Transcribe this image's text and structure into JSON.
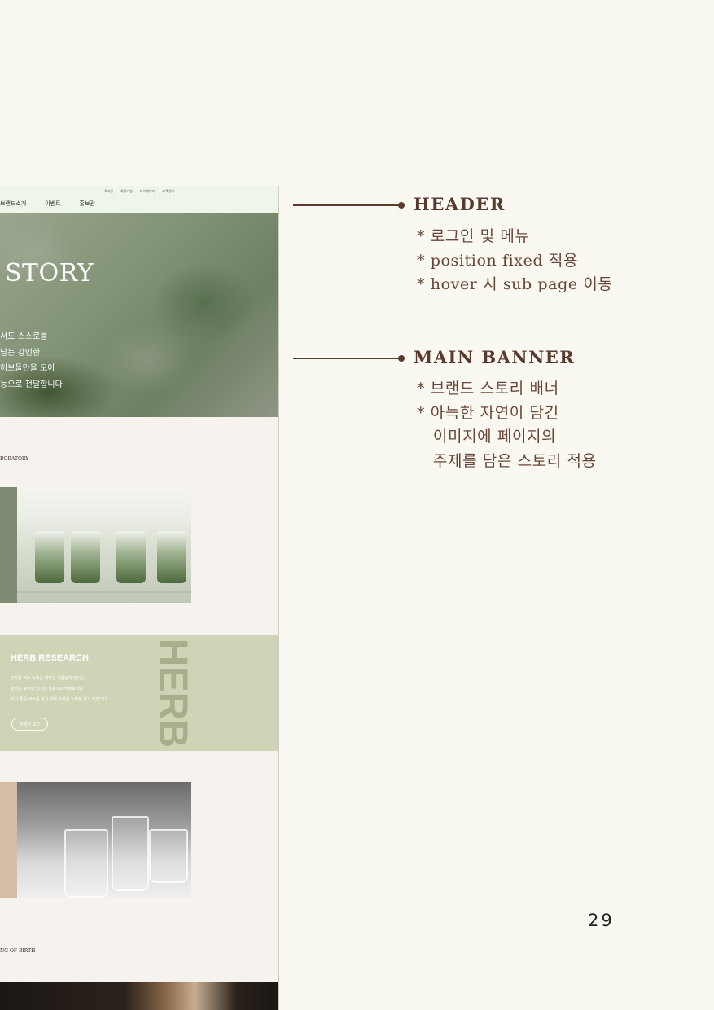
{
  "mockup": {
    "header": {
      "utility": [
        "로그인",
        "회원가입",
        "마이페이지",
        "고객센터"
      ],
      "nav": [
        "브랜드소개",
        "이벤트",
        "홍보관"
      ]
    },
    "banner": {
      "title": "STORY",
      "lines": [
        "서도 스스로를",
        "남는 강인한",
        "허브들만을 모아",
        "능으로 전달합니다"
      ]
    },
    "section1_label": "BORATORY",
    "herb": {
      "title": "HERB RESEARCH",
      "lines": [
        "건강한 허브 속에는 피부를 아름답게 만드는",
        "놀라운 능력이 있다는 믿음으로 허브효과는",
        "보다 좋은 허브를 찾기 위해 수많은 노력을 하고 있습니다"
      ],
      "button": "자세히 보기",
      "vertical": "HERB"
    },
    "section2_label": "NG OF BIRTH"
  },
  "annotations": [
    {
      "title": "HEADER",
      "items": [
        "* 로그인 및 메뉴",
        "*  position fixed 적용",
        "*  hover 시 sub page 이동"
      ]
    },
    {
      "title": "MAIN BANNER",
      "items": [
        "* 브랜드 스토리 배너",
        "* 아늑한 자연이 담긴",
        "   이미지에 페이지의",
        "   주제를 담은 스토리 적용"
      ]
    }
  ],
  "page_number": "29",
  "colors": {
    "background": "#f9f8f1",
    "accent": "#5a3a2e",
    "header_bg": "#eef6ea",
    "herb_bg": "#d0d4b6"
  }
}
